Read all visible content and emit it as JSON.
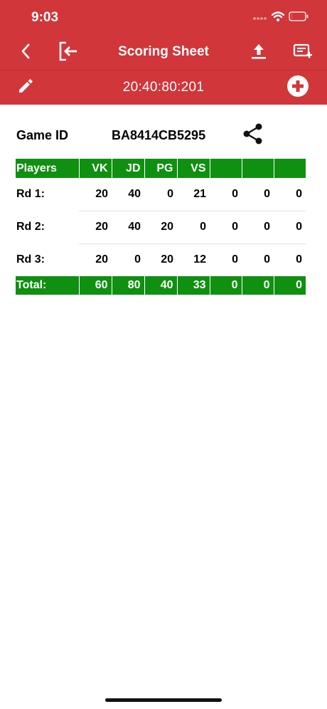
{
  "status_bar": {
    "time": "9:03"
  },
  "nav": {
    "title": "Scoring Sheet",
    "icons": [
      "back-chevron-icon",
      "exit-icon",
      "upload-icon",
      "add-note-icon"
    ]
  },
  "toolbar": {
    "timer": "20:40:80:201",
    "icons": [
      "pencil-icon",
      "plus-circle-icon"
    ]
  },
  "game": {
    "label": "Game ID",
    "id": "BA8414CB5295",
    "share_icon": "share-icon"
  },
  "table": {
    "headers": [
      "Players",
      "VK",
      "JD",
      "PG",
      "VS",
      "",
      "",
      ""
    ],
    "rows": [
      {
        "label": "Rd 1:",
        "values": [
          "20",
          "40",
          "0",
          "21",
          "0",
          "0",
          "0"
        ]
      },
      {
        "label": "Rd 2:",
        "values": [
          "20",
          "40",
          "20",
          "0",
          "0",
          "0",
          "0"
        ]
      },
      {
        "label": "Rd 3:",
        "values": [
          "20",
          "0",
          "20",
          "12",
          "0",
          "0",
          "0"
        ]
      }
    ],
    "total": {
      "label": "Total:",
      "values": [
        "60",
        "80",
        "40",
        "33",
        "0",
        "0",
        "0"
      ]
    }
  },
  "colors": {
    "header_red": "#d0363a",
    "table_green": "#109010"
  }
}
